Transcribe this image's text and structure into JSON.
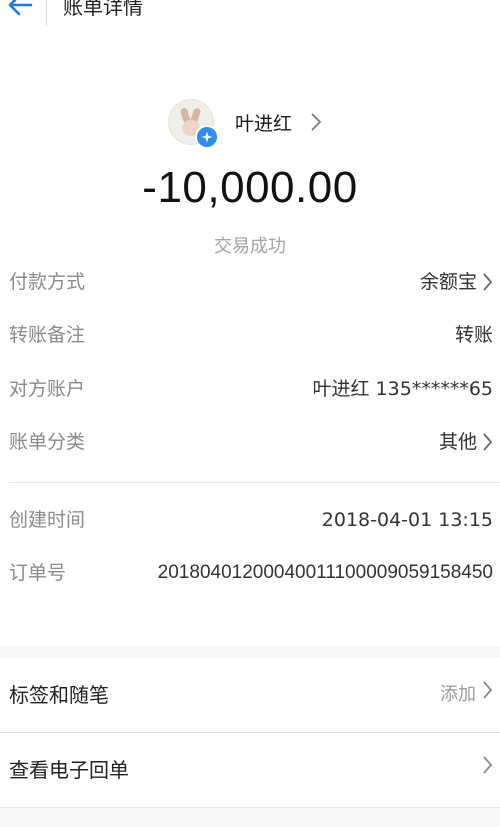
{
  "header": {
    "title": "账单详情"
  },
  "payee": {
    "name": "叶进红"
  },
  "amount": "-10,000.00",
  "status": "交易成功",
  "details": {
    "payment_method": {
      "label": "付款方式",
      "value": "余额宝"
    },
    "transfer_note": {
      "label": "转账备注",
      "value": "转账"
    },
    "counterparty": {
      "label": "对方账户",
      "value": "叶进红 135******65"
    },
    "category": {
      "label": "账单分类",
      "value": "其他"
    },
    "created_time": {
      "label": "创建时间",
      "value": "2018-04-01 13:15"
    },
    "order_no": {
      "label": "订单号",
      "value": "20180401200040011100009059158450"
    }
  },
  "actions": {
    "tags": {
      "label": "标签和随笔",
      "hint": "添加"
    },
    "receipt": {
      "label": "查看电子回单"
    }
  },
  "colors": {
    "accent_blue": "#2f8ee8",
    "back_arrow": "#1f7ae0"
  },
  "icons": [
    "back-arrow-icon",
    "verified-badge-icon",
    "chevron-right-icon"
  ]
}
